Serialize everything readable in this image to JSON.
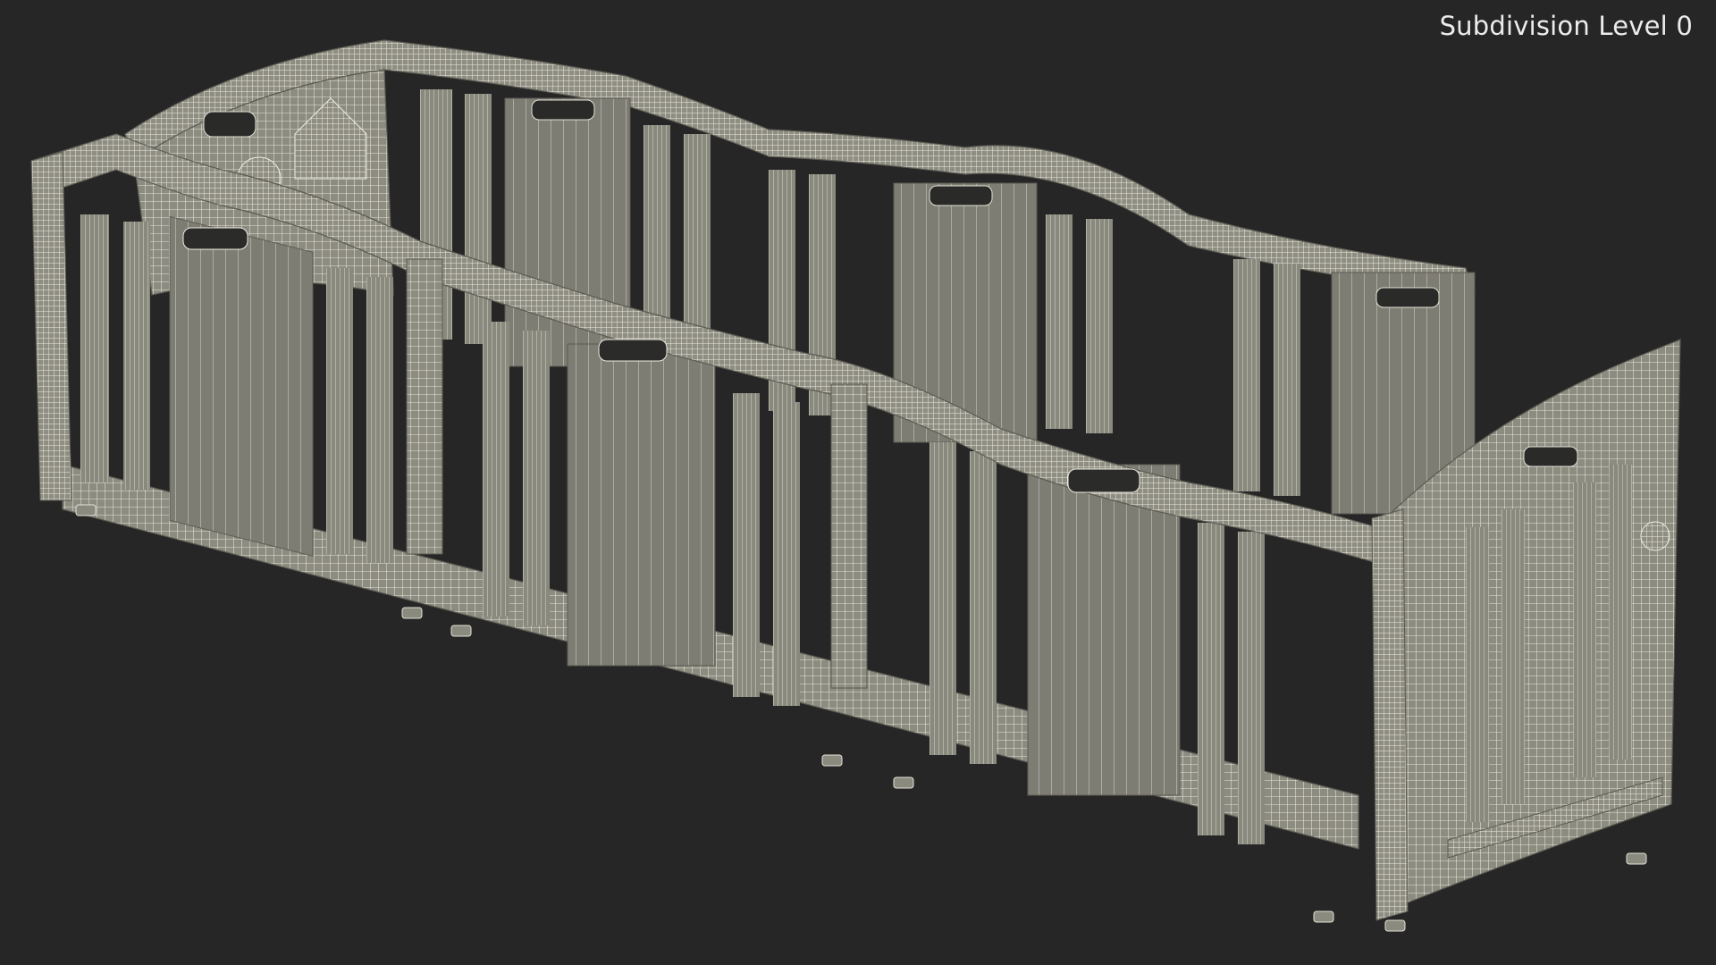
{
  "viewport": {
    "subdivision_label": "Subdivision Level 0",
    "background_color": "#262626"
  },
  "model": {
    "name": "playpen-wireframe",
    "surface_color": "#8c8b80",
    "panel_color": "#7f7e74",
    "wire_color": "#e9e8dc",
    "shadow_color": "#5f5e56",
    "front_panels": 4,
    "back_panels": 4,
    "side_panels": 1
  }
}
